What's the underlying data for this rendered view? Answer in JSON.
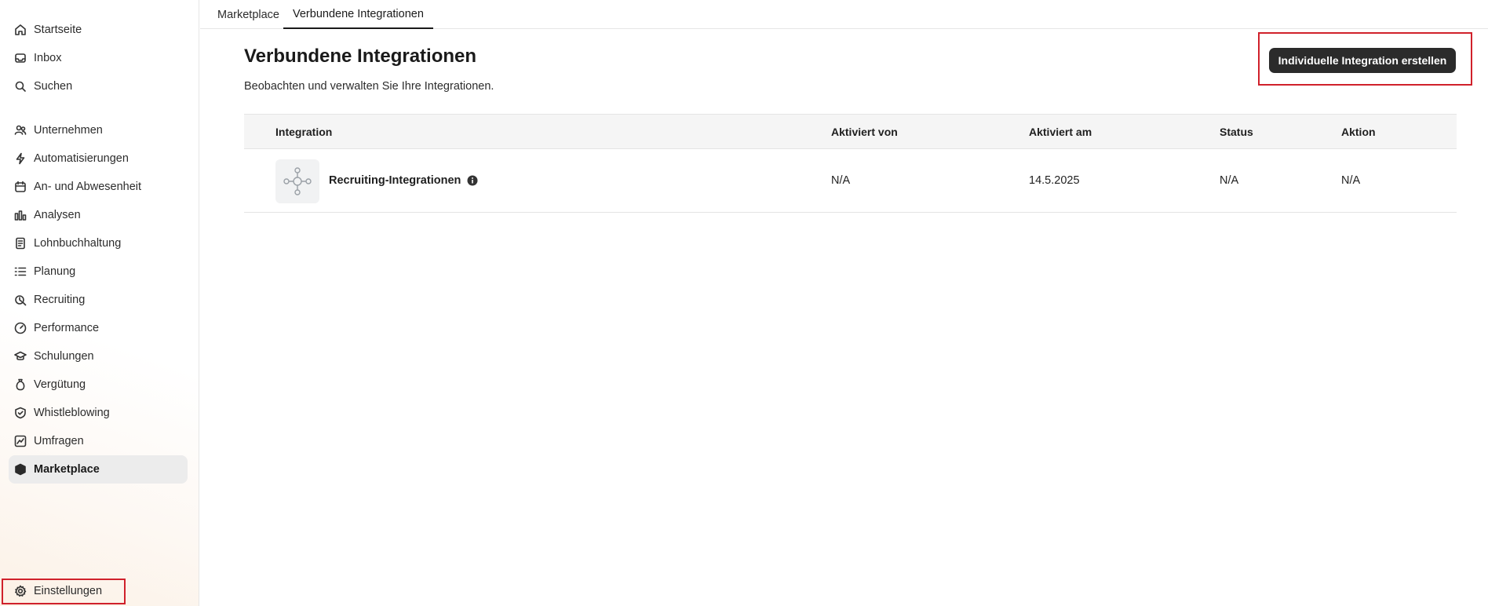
{
  "sidebar": {
    "items": [
      {
        "label": "Startseite",
        "icon": "home-icon"
      },
      {
        "label": "Inbox",
        "icon": "inbox-icon"
      },
      {
        "label": "Suchen",
        "icon": "search-icon"
      },
      {
        "label": "Unternehmen",
        "icon": "users-icon"
      },
      {
        "label": "Automatisierungen",
        "icon": "lightning-icon"
      },
      {
        "label": "An- und Abwesenheit",
        "icon": "calendar-icon"
      },
      {
        "label": "Analysen",
        "icon": "bar-chart-icon"
      },
      {
        "label": "Lohnbuchhaltung",
        "icon": "document-icon"
      },
      {
        "label": "Planung",
        "icon": "list-icon"
      },
      {
        "label": "Recruiting",
        "icon": "recruiting-icon"
      },
      {
        "label": "Performance",
        "icon": "gauge-icon"
      },
      {
        "label": "Schulungen",
        "icon": "graduation-cap-icon"
      },
      {
        "label": "Vergütung",
        "icon": "money-bag-icon"
      },
      {
        "label": "Whistleblowing",
        "icon": "shield-check-icon"
      },
      {
        "label": "Umfragen",
        "icon": "trend-chart-icon"
      },
      {
        "label": "Marketplace",
        "icon": "cube-icon",
        "active": true
      }
    ],
    "settings": {
      "label": "Einstellungen",
      "icon": "gear-icon"
    }
  },
  "tabs": [
    {
      "label": "Marketplace",
      "active": false
    },
    {
      "label": "Verbundene Integrationen",
      "active": true
    }
  ],
  "header": {
    "title": "Verbundene Integrationen",
    "subtitle": "Beobachten und verwalten Sie Ihre Integrationen.",
    "create_button": "Individuelle Integration erstellen"
  },
  "table": {
    "columns": [
      "Integration",
      "Aktiviert von",
      "Aktiviert am",
      "Status",
      "Aktion"
    ],
    "rows": [
      {
        "integration": "Recruiting-Integrationen",
        "activated_by": "N/A",
        "activated_on": "14.5.2025",
        "status": "N/A",
        "action": "N/A"
      }
    ]
  },
  "colors": {
    "highlight": "#d0212b",
    "button_bg": "#2b2b2b",
    "active_nav_bg": "#ececec"
  }
}
